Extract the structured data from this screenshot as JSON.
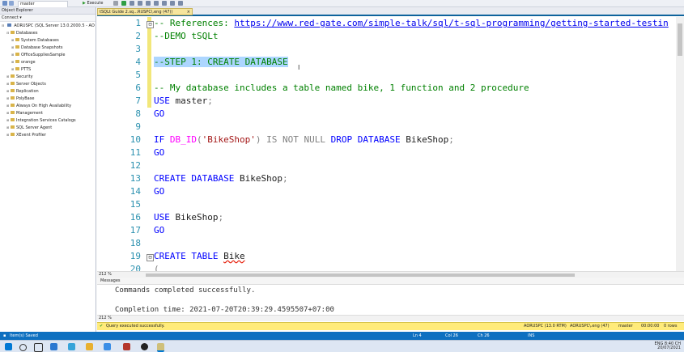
{
  "toolbar": {
    "database": "master",
    "execute": "Execute"
  },
  "object_explorer": {
    "title": "Object Explorer",
    "connect": "Connect ▾",
    "server": "AORUSPC (SQL Server 13.0.2000.5 - AO",
    "items": [
      {
        "label": "Databases",
        "indent": 1,
        "expand": "⊟"
      },
      {
        "label": "System Databases",
        "indent": 2,
        "expand": "⊞"
      },
      {
        "label": "Database Snapshots",
        "indent": 2,
        "expand": "⊞"
      },
      {
        "label": "OfficeSuppliesSample",
        "indent": 2,
        "expand": "⊞"
      },
      {
        "label": "orange",
        "indent": 2,
        "expand": "⊞"
      },
      {
        "label": "PTTS",
        "indent": 2,
        "expand": "⊞"
      },
      {
        "label": "Security",
        "indent": 1,
        "expand": "⊞"
      },
      {
        "label": "Server Objects",
        "indent": 1,
        "expand": "⊞"
      },
      {
        "label": "Replication",
        "indent": 1,
        "expand": "⊞"
      },
      {
        "label": "PolyBase",
        "indent": 1,
        "expand": "⊞"
      },
      {
        "label": "Always On High Availability",
        "indent": 1,
        "expand": "⊞"
      },
      {
        "label": "Management",
        "indent": 1,
        "expand": "⊞"
      },
      {
        "label": "Integration Services Catalogs",
        "indent": 1,
        "expand": "⊞"
      },
      {
        "label": "SQL Server Agent",
        "indent": 1,
        "expand": "⊞"
      },
      {
        "label": "XEvent Profiler",
        "indent": 1,
        "expand": "⊞"
      }
    ]
  },
  "tab": {
    "label": "tSQLt Guide 2.sq...RUSPC\\.eng (47))",
    "close": "×"
  },
  "editor": {
    "lines": [
      {
        "n": "1",
        "fold": "⊟",
        "tokens": [
          {
            "t": "-- References: ",
            "c": "cm"
          },
          {
            "t": "https://www.red-gate.com/simple-talk/sql/t-sql-programming/getting-started-testin",
            "c": "link"
          }
        ]
      },
      {
        "n": "2",
        "tokens": [
          {
            "t": "--DEMO tSQLt",
            "c": "cm"
          }
        ]
      },
      {
        "n": "3",
        "tokens": []
      },
      {
        "n": "4",
        "tokens": [
          {
            "t": "--STEP 1: CREATE DATABASE",
            "c": "cm sel"
          }
        ]
      },
      {
        "n": "5",
        "tokens": []
      },
      {
        "n": "6",
        "tokens": [
          {
            "t": "-- My database includes a table named bike, 1 function and 2 procedure",
            "c": "cm"
          }
        ]
      },
      {
        "n": "7",
        "tokens": [
          {
            "t": "USE",
            "c": "kw"
          },
          {
            "t": " master",
            "c": ""
          },
          {
            "t": ";",
            "c": "gray"
          }
        ]
      },
      {
        "n": "8",
        "tokens": [
          {
            "t": "GO",
            "c": "kw"
          }
        ]
      },
      {
        "n": "9",
        "tokens": []
      },
      {
        "n": "10",
        "tokens": [
          {
            "t": "IF ",
            "c": "kw"
          },
          {
            "t": "DB_ID",
            "c": "fn"
          },
          {
            "t": "(",
            "c": "gray"
          },
          {
            "t": "'BikeShop'",
            "c": "str"
          },
          {
            "t": ") IS NOT NULL ",
            "c": "gray"
          },
          {
            "t": "DROP DATABASE",
            "c": "kw"
          },
          {
            "t": " BikeShop",
            "c": ""
          },
          {
            "t": ";",
            "c": "gray"
          }
        ]
      },
      {
        "n": "11",
        "tokens": [
          {
            "t": "GO",
            "c": "kw"
          }
        ]
      },
      {
        "n": "12",
        "tokens": []
      },
      {
        "n": "13",
        "tokens": [
          {
            "t": "CREATE DATABASE",
            "c": "kw"
          },
          {
            "t": " BikeShop",
            "c": ""
          },
          {
            "t": ";",
            "c": "gray"
          }
        ]
      },
      {
        "n": "14",
        "tokens": [
          {
            "t": "GO",
            "c": "kw"
          }
        ]
      },
      {
        "n": "15",
        "tokens": []
      },
      {
        "n": "16",
        "tokens": [
          {
            "t": "USE",
            "c": "kw"
          },
          {
            "t": " BikeShop",
            "c": ""
          },
          {
            "t": ";",
            "c": "gray"
          }
        ]
      },
      {
        "n": "17",
        "tokens": [
          {
            "t": "GO",
            "c": "kw"
          }
        ]
      },
      {
        "n": "18",
        "tokens": []
      },
      {
        "n": "19",
        "fold": "⊟",
        "tokens": [
          {
            "t": "CREATE TABLE",
            "c": "kw"
          },
          {
            "t": " ",
            "c": ""
          },
          {
            "t": "Bike",
            "c": "squiggle"
          }
        ]
      },
      {
        "n": "20",
        "tokens": [
          {
            "t": "(",
            "c": "gray"
          }
        ]
      }
    ]
  },
  "zoom": "212 %",
  "zoom2": "212 %",
  "results": {
    "tab": "Messages",
    "line1": "Commands completed successfully.",
    "line2": "Completion time: 2021-07-20T20:39:29.4595507+07:00"
  },
  "query_status": {
    "message": "Query executed successfully.",
    "server": "AORUSPC (13.0 RTM)",
    "user": "AORUSPC\\.eng (47)",
    "db": "master",
    "time": "00:00:00",
    "rows": "0 rows"
  },
  "status": {
    "left": "Item(s) Saved",
    "ln": "Ln 4",
    "col": "Col 26",
    "ch": "Ch 26",
    "ins": "INS"
  },
  "tray": {
    "lang": "ENG",
    "time": "8:40 CH",
    "date": "20/07/2021"
  },
  "colors": {
    "accent": "#0e70c0",
    "selection": "#add6ff",
    "yellow_margin": "#f2e77a",
    "query_ok": "#ffeb7a"
  }
}
